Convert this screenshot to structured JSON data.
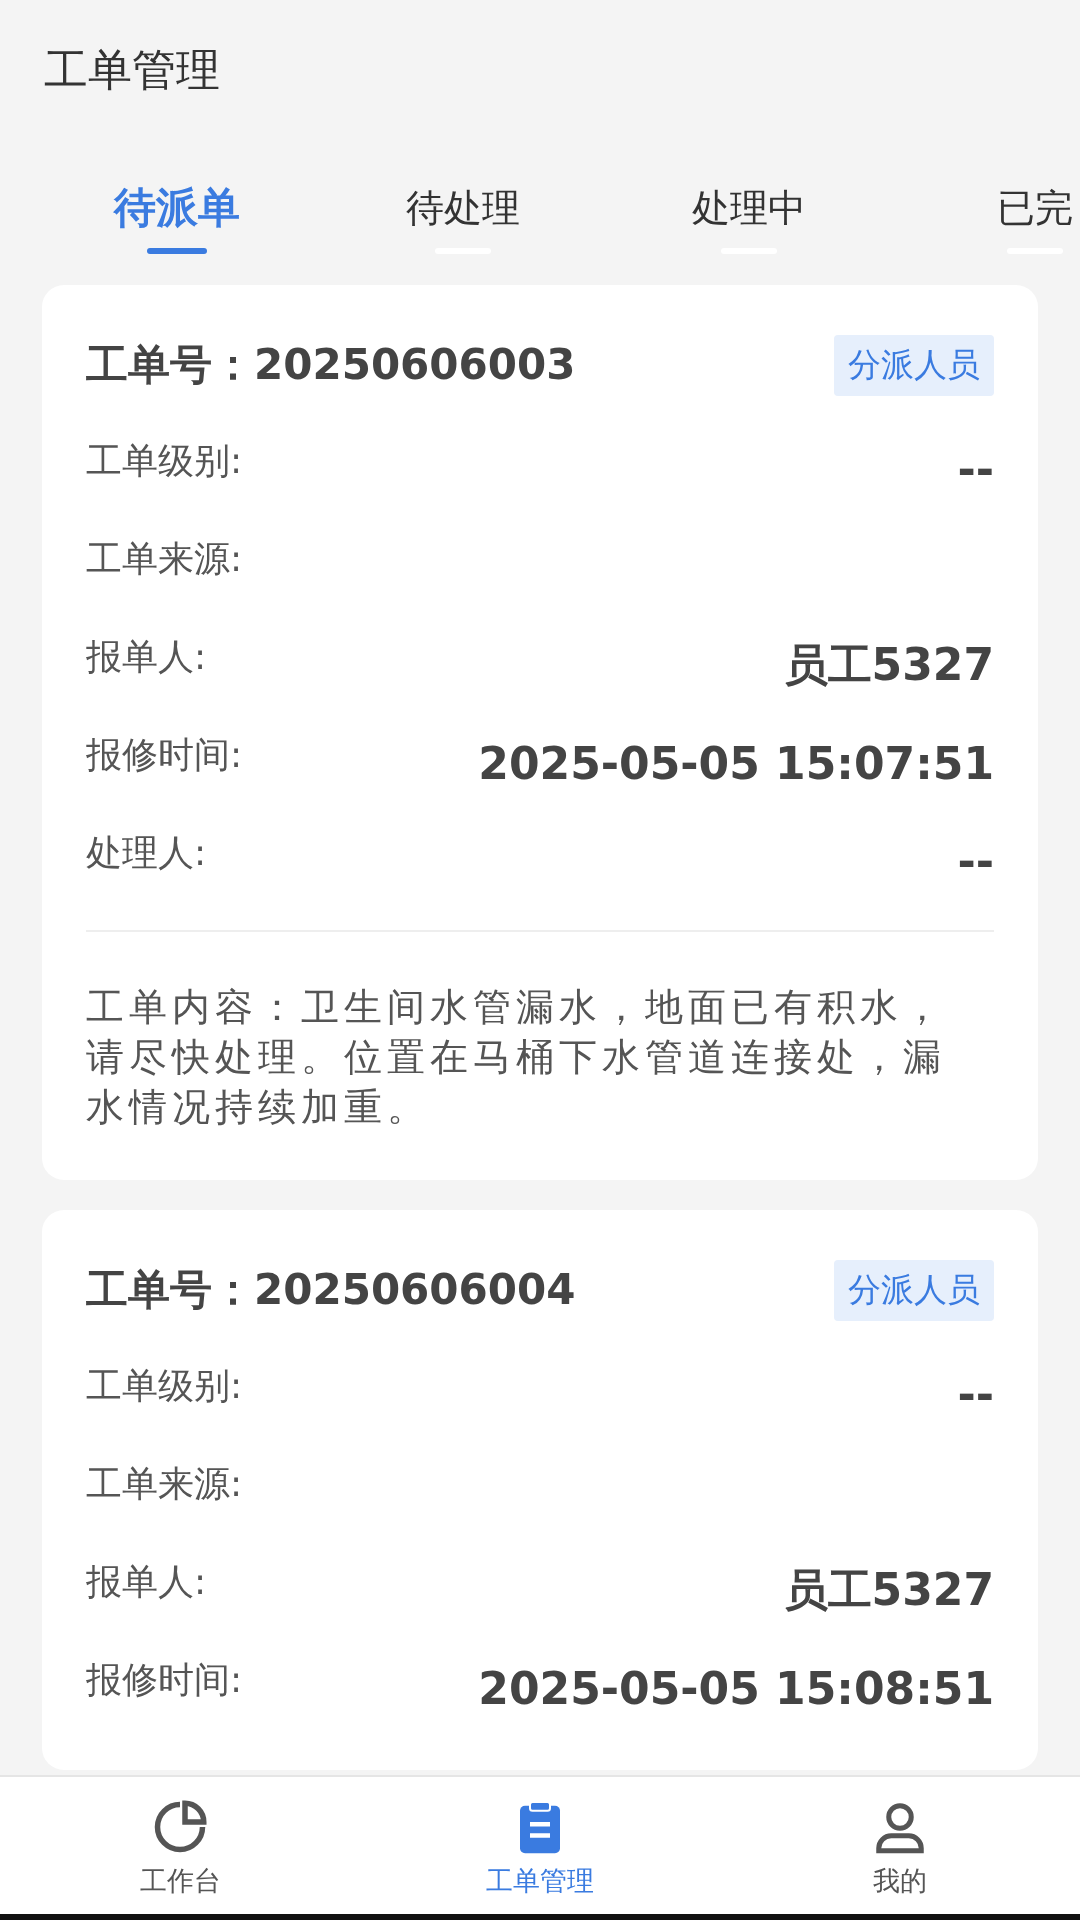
{
  "header": {
    "title": "工单管理"
  },
  "tabs": [
    {
      "label": "待派单",
      "selected": true
    },
    {
      "label": "待处理",
      "selected": false
    },
    {
      "label": "处理中",
      "selected": false
    },
    {
      "label": "已完",
      "selected": false
    }
  ],
  "orders": [
    {
      "number": "工单号：20250606003",
      "action": "分派人员",
      "fields": [
        {
          "label": "工单级别:",
          "value": "--"
        },
        {
          "label": "工单来源:"
        },
        {
          "label": "报单人:",
          "value": "员工5327"
        },
        {
          "label": "报修时间:",
          "value": "2025-05-05 15:07:51"
        },
        {
          "label": "处理人:",
          "value": "--"
        }
      ],
      "content": "工单内容：卫生间水管漏水，地面已有积水，请尽快处理。位置在马桶下水管道连接处，漏水情况持续加重。"
    },
    {
      "number": "工单号：20250606004",
      "action": "分派人员",
      "fields": [
        {
          "label": "工单级别:",
          "value": "--"
        },
        {
          "label": "工单来源:"
        },
        {
          "label": "报单人:",
          "value": "员工5327"
        },
        {
          "label": "报修时间:",
          "value": "2025-05-05 15:08:51"
        }
      ]
    }
  ],
  "nav": [
    {
      "label": "工作台",
      "kind": "dashboard",
      "selected": false
    },
    {
      "label": "工单管理",
      "kind": "orders",
      "selected": true
    },
    {
      "label": "我的",
      "kind": "profile",
      "selected": false
    }
  ]
}
